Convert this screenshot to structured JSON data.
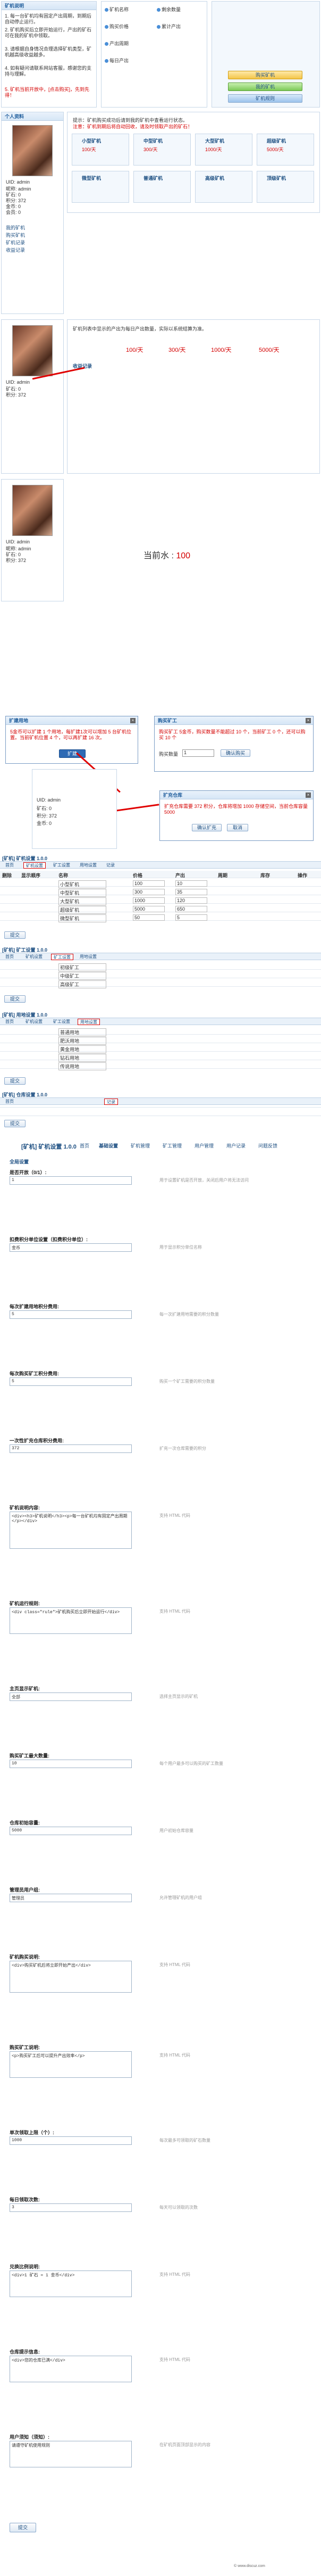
{
  "top": {
    "section_title": "矿机说明",
    "bullets": [
      "1. 每一台矿机均有固定产出周期，到期后自动停止运行。",
      "2. 矿机购买后立即开始运行，产出的矿石可在我的矿机中领取。",
      "3. 请根据自身情况合理选择矿机类型，矿机越高级收益越多。",
      "4. 如有疑问请联系网站客服，感谢您的支持与理解。"
    ],
    "highlight": "5. 矿机当前开放中，[点击购买]，先到先得！",
    "side_items": [
      "矿机名称",
      "购买价格",
      "产出周期",
      "每日产出",
      "剩余数量",
      "累计产出"
    ],
    "buttons": [
      "购买矿机",
      "我的矿机",
      "矿机规则"
    ]
  },
  "profile": {
    "tab_title": "个人资料",
    "lines": [
      "UID: admin",
      "昵称: admin",
      "矿石: 0",
      "积分: 372",
      "金币: 0",
      "会员: 0",
      "威望: 0",
      "贡献: 0"
    ],
    "menu": [
      "我的矿机",
      "购买矿机",
      "矿机记录",
      "收益记录"
    ],
    "notice": "提示：矿机购买成功后请到我的矿机中查看运行状态。",
    "red_notice": "注意：矿机到期后将自动回收，请及时领取产出的矿石！"
  },
  "cards": {
    "row1": [
      "小型矿机",
      "中型矿机",
      "大型矿机",
      "超级矿机"
    ],
    "row2": [
      "微型矿机",
      "普通矿机",
      "高级矿机",
      "顶级矿机"
    ],
    "price_label": "价格",
    "output_label": "产出"
  },
  "profile2": {
    "notice": "矿机列表中显示的产出为每日产出数量，实际以系统结算为准。",
    "prices": [
      "100/天",
      "300/天",
      "1000/天",
      "5000/天"
    ],
    "result_header": "收益记录"
  },
  "profile3": {
    "current_label": "当前水",
    "current_value": "100"
  },
  "modal1": {
    "title": "扩建用地",
    "text": "5金币可以扩建 1 个用地，每扩建1次可以增加 5 台矿机位置。当前矿机位置 4 个，可以再扩建 16 次。",
    "button": "扩建"
  },
  "modal2": {
    "title": "购买矿工",
    "text": "购买矿工 5金币，购买数量不能超过 10 个，当前矿工 0 个，还可以购买 10 个",
    "qty_label": "购买数量",
    "qty_value": "1",
    "confirm": "确认购买",
    "cancel": "取消"
  },
  "modal3": {
    "title": "扩充仓库",
    "text": "扩充仓库需要 372 积分，仓库将增加 1000 存储空间，当前仓库容量 5000",
    "confirm": "确认扩充",
    "cancel": "取消"
  },
  "admin1": {
    "title": "[矿机] 矿机设置 1.0.0",
    "tabs": [
      "首页",
      "矿机设置",
      "矿工设置",
      "用地设置",
      "记录"
    ],
    "headers": [
      "删除",
      "显示顺序",
      "名称",
      "价格",
      "产出",
      "周期",
      "库存",
      "操作"
    ],
    "rows": [
      {
        "name": "小型矿机",
        "price": "100",
        "output": "10"
      },
      {
        "name": "中型矿机",
        "price": "300",
        "output": "35"
      },
      {
        "name": "大型矿机",
        "price": "1000",
        "output": "120"
      },
      {
        "name": "超级矿机",
        "price": "5000",
        "output": "650"
      },
      {
        "name": "微型矿机",
        "price": "50",
        "output": "5"
      }
    ],
    "submit": "提交"
  },
  "admin2": {
    "title": "[矿机] 矿工设置 1.0.0",
    "rows": [
      "初级矿工",
      "中级矿工",
      "高级矿工"
    ],
    "submit": "提交"
  },
  "admin3": {
    "title": "[矿机] 用地设置 1.0.0",
    "rows": [
      "普通用地",
      "肥沃用地",
      "黄金用地",
      "钻石用地",
      "传说用地"
    ],
    "submit": "提交"
  },
  "admin4": {
    "title": "[矿机] 仓库设置 1.0.0",
    "submit": "提交"
  },
  "settings": {
    "header_title": "[矿机] 矿机设置 1.0.0",
    "tabs": [
      "首页",
      "基础设置",
      "矿机管理",
      "矿工管理",
      "用户管理",
      "用户记录",
      "问题反馈"
    ],
    "section": "全局设置",
    "fields": [
      {
        "label": "是否开放（0/1）:",
        "value": "1",
        "help": "用于设置矿机是否开放，关闭后用户将无法访问"
      },
      {
        "label": "扣费积分单位设置（扣费积分单位）:",
        "value": "金币",
        "help": "用于显示积分单位名称"
      },
      {
        "label": "每次扩建用地积分费用:",
        "value": "5",
        "help": "每一次扩建用地需要的积分数量"
      },
      {
        "label": "每次购买矿工积分费用:",
        "value": "5",
        "help": "购买一个矿工需要的积分数量"
      },
      {
        "label": "一次性扩充仓库积分费用:",
        "value": "372",
        "help": "扩充一次仓库需要的积分"
      },
      {
        "label": "矿机说明内容:",
        "value": "<div><h3>矿机说明</h3><p>每一台矿机均有固定产出周期</p></div>",
        "help": "支持 HTML 代码"
      },
      {
        "label": "矿机运行规则:",
        "value": "<div class=\"rule\">矿机购买后立即开始运行</div>",
        "help": "支持 HTML 代码"
      },
      {
        "label": "主页显示矿机:",
        "value": "全部",
        "help": "选择主页显示的矿机"
      },
      {
        "label": "购买矿工最大数量:",
        "value": "10",
        "help": "每个用户最多可以购买的矿工数量"
      },
      {
        "label": "仓库初始容量:",
        "value": "5000",
        "help": "用户初始仓库容量"
      },
      {
        "label": "管理员用户组:",
        "value": "管理员",
        "help": "允许管理矿机的用户组"
      },
      {
        "label": "矿机购买说明:",
        "value": "<div>购买矿机后将立即开始产出</div>",
        "help": "支持 HTML 代码"
      },
      {
        "label": "购买矿工说明:",
        "value": "<p>购买矿工后可以提升产出效率</p>",
        "help": "支持 HTML 代码"
      },
      {
        "label": "单次领取上限（个）:",
        "value": "1000",
        "help": "每次最多可领取的矿石数量"
      },
      {
        "label": "每日领取次数:",
        "value": "3",
        "help": "每天可以领取的次数"
      },
      {
        "label": "兑换比例说明:",
        "value": "<div>1 矿石 = 1 金币</div>",
        "help": "支持 HTML 代码"
      },
      {
        "label": "仓库提示信息:",
        "value": "<div>您的仓库已满</div>",
        "help": "支持 HTML 代码"
      },
      {
        "label": "用户须知（须知）:",
        "value": "请遵守矿机使用规则",
        "help": "在矿机页面顶部显示的内容"
      }
    ],
    "save": "提交",
    "footer": "© www.discuz.com"
  }
}
